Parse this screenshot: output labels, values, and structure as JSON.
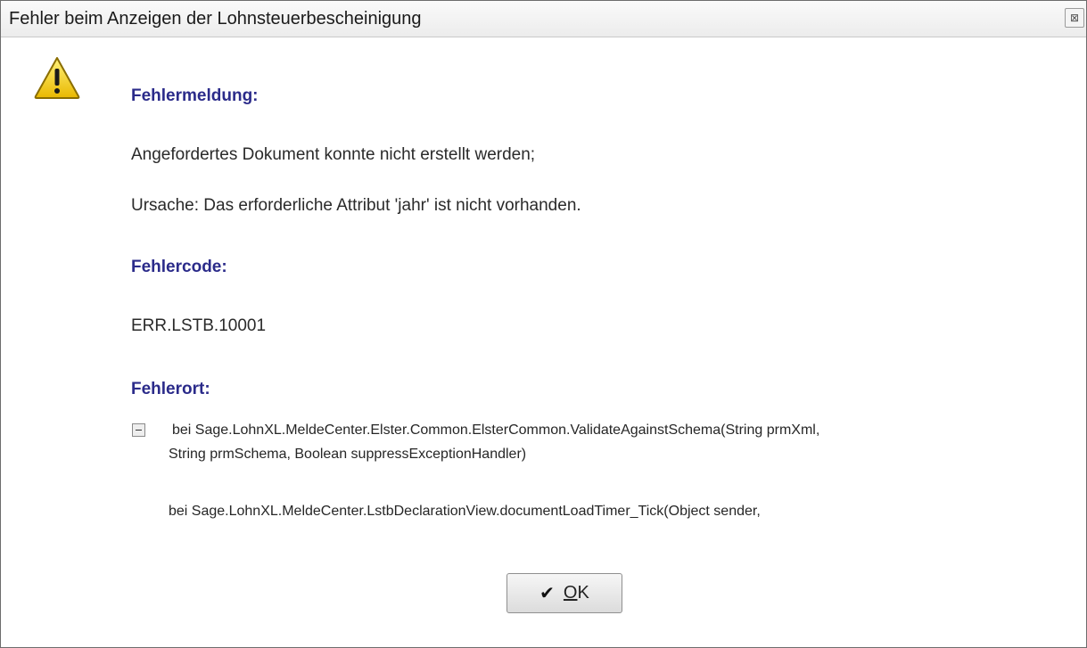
{
  "window": {
    "title": "Fehler beim Anzeigen der Lohnsteuerbescheinigung",
    "close_glyph": "⊠"
  },
  "message": {
    "error_heading": "Fehlermeldung:",
    "line1": "Angefordertes Dokument konnte nicht erstellt werden;",
    "line2": "Ursache: Das erforderliche Attribut 'jahr' ist nicht vorhanden.",
    "code_heading": "Fehlercode:",
    "code": "ERR.LSTB.10001",
    "location_heading": "Fehlerort:"
  },
  "stack_trace": {
    "line1": "bei Sage.LohnXL.MeldeCenter.Elster.Common.ElsterCommon.ValidateAgainstSchema(String prmXml,",
    "line2": "String prmSchema, Boolean suppressExceptionHandler)",
    "line3": "bei Sage.LohnXL.MeldeCenter.LstbDeclarationView.documentLoadTimer_Tick(Object sender,"
  },
  "buttons": {
    "ok_check": "✔",
    "ok_mnemonic": "O",
    "ok_rest": "K"
  },
  "icons": {
    "warning": "warning-triangle-icon",
    "close": "close-icon",
    "collapse": "collapse-minus-icon",
    "check": "check-icon"
  },
  "colors": {
    "heading": "#2b2b8a",
    "warning_fill": "#f5d21a"
  }
}
